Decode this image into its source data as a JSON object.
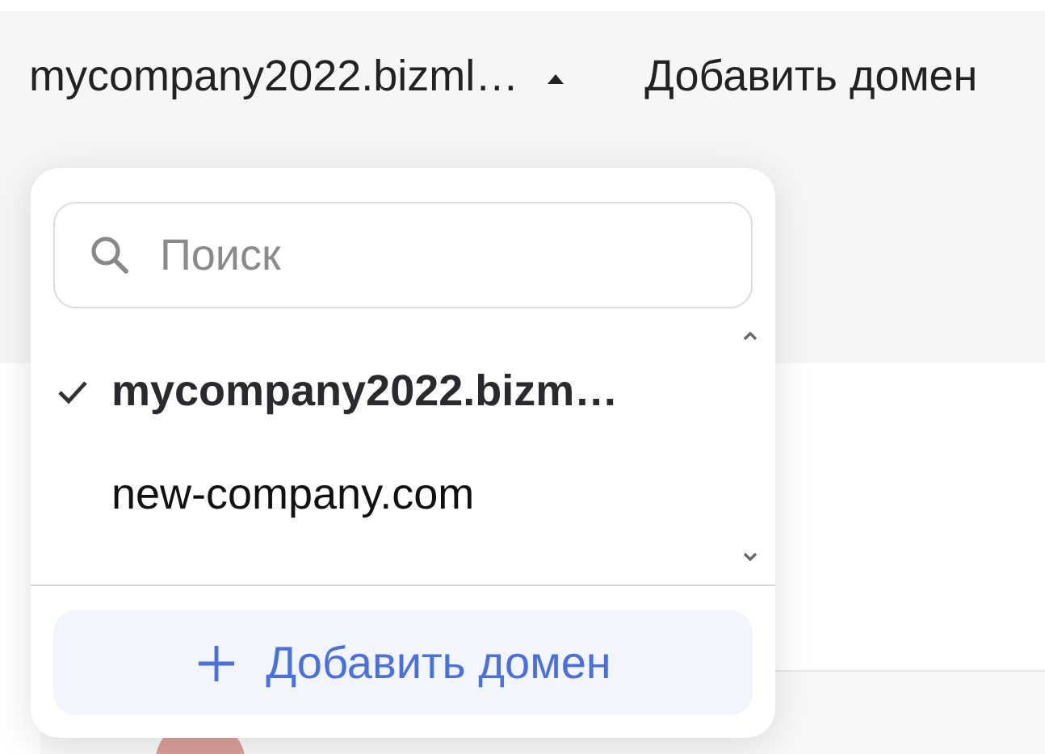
{
  "header": {
    "domain_switcher": {
      "label": "mycompany2022.bizml…",
      "expanded": true
    },
    "add_domain_link": "Добавить домен"
  },
  "dropdown": {
    "search": {
      "placeholder": "Поиск"
    },
    "items": [
      {
        "label": "mycompany2022.bizm…",
        "selected": true
      },
      {
        "label": "new-company.com",
        "selected": false
      }
    ],
    "add_button": "Добавить домен"
  },
  "background_row": {
    "avatar": {
      "kind": "avatar"
    }
  }
}
